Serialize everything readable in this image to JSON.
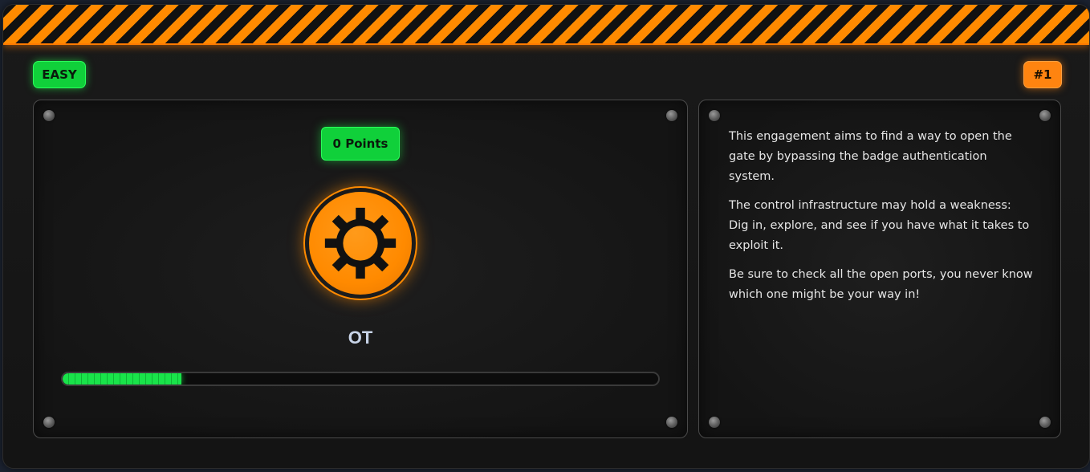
{
  "card": {
    "difficulty": "EASY",
    "rank": "#1"
  },
  "challenge": {
    "points_label": "0 Points",
    "category": "OT",
    "category_icon": "gear-icon",
    "progress": 0.2
  },
  "description": {
    "paragraphs": [
      "This engagement aims to find a way to open the gate by bypassing the badge authentication system.",
      "The control infrastructure may hold a weakness: Dig in, explore, and see if you have what it takes to exploit it.",
      "Be sure to check all the open ports, you never know which one might be your way in!"
    ]
  },
  "colors": {
    "accent_orange": "#ff8a00",
    "success_green": "#10d03a",
    "background": "#141414"
  }
}
